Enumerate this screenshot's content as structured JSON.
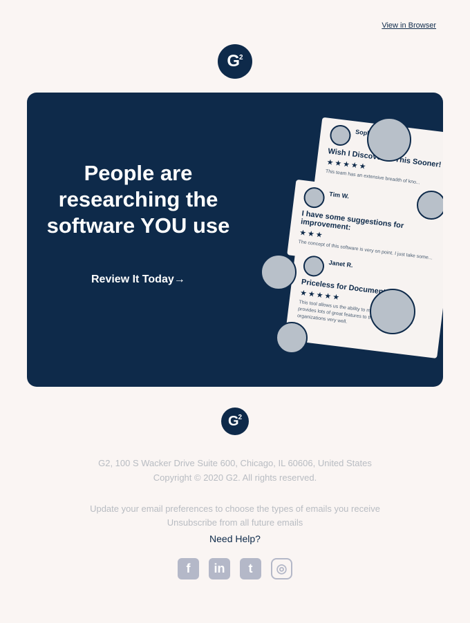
{
  "header": {
    "view_in_browser": "View in Browser"
  },
  "logo": {
    "mark": "G",
    "sup": "2"
  },
  "hero": {
    "headline": "People are researching the software YOU use",
    "cta": "Review It Today→",
    "cards": [
      {
        "name": "Sophie",
        "meta1": "",
        "meta2": "",
        "title": "Wish I Discovered This Sooner!",
        "stars": "★★★★★",
        "body": "This team has an extensive breadth of kno..."
      },
      {
        "name": "Tim W.",
        "meta1": "",
        "meta2": "",
        "title": "I have some suggestions for improvement:",
        "stars": "★★★",
        "body": "The concept of this software is very on point. I just take some..."
      },
      {
        "name": "Janet R.",
        "meta1": "",
        "meta2": "",
        "title": "Priceless for Documentation",
        "stars": "★★★★★",
        "body": "This tool allows us the ability to manage ... and go... It provides lots of great features to the consultant and to organizations very well."
      }
    ]
  },
  "footer": {
    "address": "G2, 100 S Wacker Drive Suite 600, Chicago, IL 60606, United States",
    "copyright": "Copyright © 2020 G2. All rights reserved.",
    "prefs_prefix": "Update your ",
    "prefs_link": "email preferences",
    "prefs_suffix": " to choose the types of emails you receive",
    "unsub_link": "Unsubscribe",
    "unsub_suffix": " from all future emails",
    "help": "Need Help?"
  },
  "social": {
    "facebook": "f",
    "linkedin": "in",
    "twitter": "t",
    "instagram": "◎"
  },
  "colors": {
    "navy": "#0e2a4a",
    "bg": "#faf5f3",
    "muted": "#b8bcc2"
  }
}
